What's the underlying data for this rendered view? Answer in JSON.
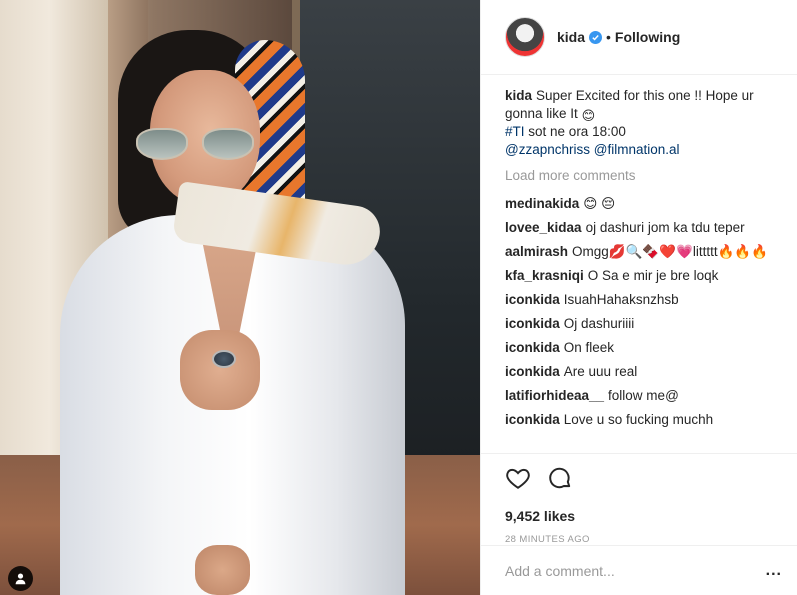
{
  "post": {
    "username": "kida",
    "separator": "•",
    "follow_status": "Following",
    "caption": {
      "username": "kida",
      "text": "Super Excited for this one !! Hope ur gonna like It",
      "emoji": "😊",
      "hashtag": "#TI",
      "hashtag_text": "sot ne ora 18:00",
      "mention1": "@zzapnchriss",
      "mention2": "@filmnation.al"
    },
    "load_more": "Load more comments",
    "comments": [
      {
        "user": "medinakida",
        "text": "😊 😔"
      },
      {
        "user": "lovee_kidaa",
        "text": "oj dashuri jom ka tdu teper"
      },
      {
        "user": "aalmirash",
        "text": "Omgg💋🔍🍫❤️💗littttt🔥🔥🔥"
      },
      {
        "user": "kfa_krasniqi",
        "text": "O Sa e mir je bre loqk"
      },
      {
        "user": "iconkida",
        "text": "IsuahHahaksnzhsb"
      },
      {
        "user": "iconkida",
        "text": "Oj dashuriiii"
      },
      {
        "user": "iconkida",
        "text": "On fleek"
      },
      {
        "user": "iconkida",
        "text": "Are uuu real"
      },
      {
        "user": "latifiorhideaa__",
        "text": "follow me@"
      },
      {
        "user": "iconkida",
        "text": "Love u so fucking muchh"
      }
    ],
    "likes": "9,452 likes",
    "timestamp": "28 MINUTES AGO",
    "comment_placeholder": "Add a comment...",
    "more_label": "..."
  },
  "icons": {
    "like": "heart-icon",
    "comment": "comment-icon",
    "verified": "verified-badge-icon",
    "user_tag": "user-tag-icon"
  },
  "colors": {
    "verified": "#3897f0",
    "link": "#003569",
    "muted": "#999999"
  }
}
